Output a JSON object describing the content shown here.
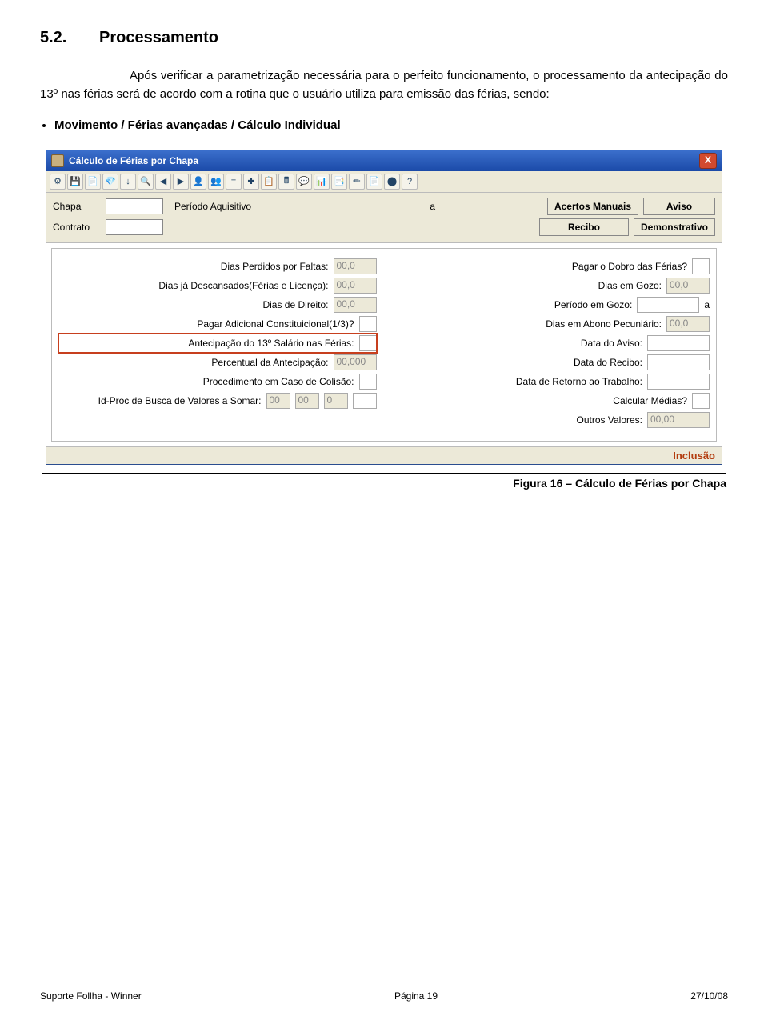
{
  "heading": {
    "num": "5.2.",
    "title": "Processamento"
  },
  "para": "Após verificar a parametrização necessária para o perfeito funcionamento, o processamento da antecipação do 13º nas férias será de acordo com a rotina que o usuário utiliza para emissão das férias, sendo:",
  "bullet": "Movimento / Férias avançadas / Cálculo Individual",
  "dialog": {
    "title": "Cálculo de Férias por Chapa",
    "close_glyph": "X",
    "toolbar_icons": [
      "⚙",
      "💾",
      "📄",
      "💎",
      "↓",
      "🔍",
      "◀",
      "▶",
      "👤",
      "👥",
      "=",
      "✚",
      "📋",
      "🖩",
      "💬",
      "📊",
      "📑",
      "✏",
      "📄",
      "⬤",
      "?"
    ],
    "labels": {
      "chapa": "Chapa",
      "periodo": "Período Aquisitivo",
      "a": "a",
      "contrato": "Contrato"
    },
    "buttons": {
      "acertos": "Acertos Manuais",
      "aviso": "Aviso",
      "recibo": "Recibo",
      "demonstrativo": "Demonstrativo"
    },
    "left_fields": [
      {
        "label": "Dias Perdidos por Faltas:",
        "val": "00,0"
      },
      {
        "label": "Dias já Descansados(Férias e Licença):",
        "val": "00,0"
      },
      {
        "label": "Dias de Direito:",
        "val": "00,0"
      },
      {
        "label": "Pagar Adicional Constituicional(1/3)?",
        "val": ""
      },
      {
        "label": "Antecipação do 13º Salário nas Férias:",
        "val": "",
        "highlight": true
      },
      {
        "label": "Percentual da Antecipação:",
        "val": "00,000"
      },
      {
        "label": "Procedimento em Caso de Colisão:",
        "val": ""
      }
    ],
    "idproc_label": "Id-Proc de Busca de Valores a Somar:",
    "idproc_vals": [
      "00",
      "00",
      "0",
      ""
    ],
    "right_fields": [
      {
        "label": "Pagar o Dobro das Férias?",
        "val": ""
      },
      {
        "label": "Dias em Gozo:",
        "val": "00,0"
      },
      {
        "label": "Período em Gozo:",
        "val": "",
        "extra": "a"
      },
      {
        "label": "Dias em Abono Pecuniário:",
        "val": "00,0"
      },
      {
        "label": "Data do Aviso:",
        "val": ""
      },
      {
        "label": "Data do Recibo:",
        "val": ""
      },
      {
        "label": "Data de Retorno ao Trabalho:",
        "val": ""
      },
      {
        "label": "Calcular Médias?",
        "val": ""
      },
      {
        "label": "Outros Valores:",
        "val": "00,00",
        "wide": true
      }
    ],
    "status": "Inclusão"
  },
  "caption": "Figura 16 – Cálculo de Férias por Chapa",
  "footer": {
    "left": "Suporte Follha - Winner",
    "center": "Página 19",
    "right": "27/10/08"
  }
}
